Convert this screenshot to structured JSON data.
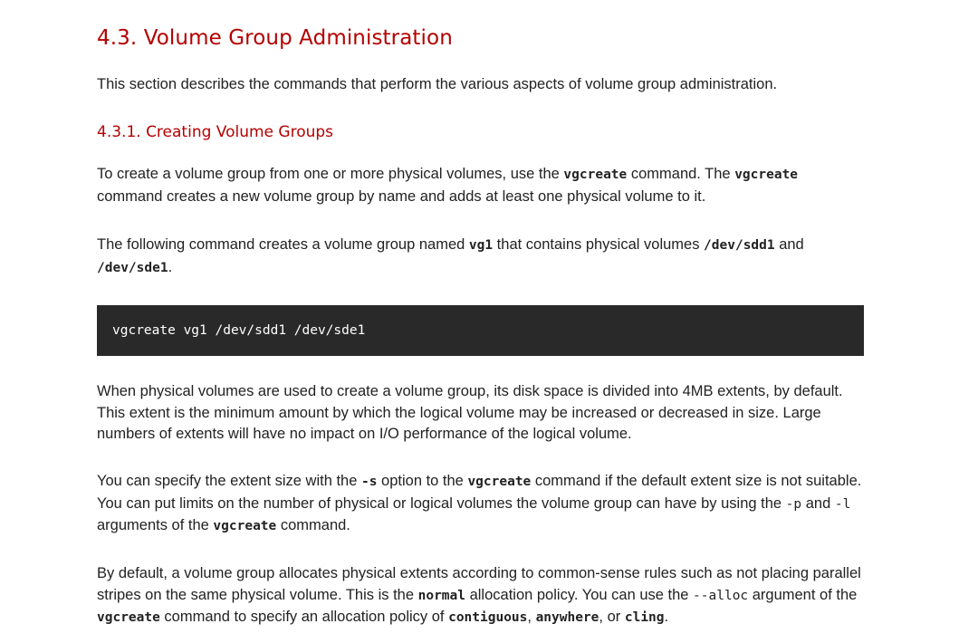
{
  "section": {
    "title": "4.3. Volume Group Administration",
    "intro": "This section describes the commands that perform the various aspects of volume group administration."
  },
  "subsection": {
    "title": "4.3.1. Creating Volume Groups"
  },
  "para_create": {
    "t1": "To create a volume group from one or more physical volumes, use the ",
    "c1": "vgcreate",
    "t2": " command. The ",
    "c2": "vgcreate",
    "t3": " command creates a new volume group by name and adds at least one physical volume to it."
  },
  "para_example": {
    "t1": "The following command creates a volume group named ",
    "c1": "vg1",
    "t2": " that contains physical volumes ",
    "c2": "/dev/sdd1",
    "t3": " and ",
    "c3": "/dev/sde1",
    "t4": "."
  },
  "code_block": {
    "command": "vgcreate vg1 /dev/sdd1 /dev/sde1"
  },
  "para_extents": {
    "text": "When physical volumes are used to create a volume group, its disk space is divided into 4MB extents, by default. This extent is the minimum amount by which the logical volume may be increased or decreased in size. Large numbers of extents will have no impact on I/O performance of the logical volume."
  },
  "para_size": {
    "t1": "You can specify the extent size with the ",
    "c1": "-s",
    "t2": " option to the ",
    "c2": "vgcreate",
    "t3": " command if the default extent size is not suitable. You can put limits on the number of physical or logical volumes the volume group can have by using the ",
    "c3": "-p",
    "t4": " and ",
    "c4": "-l",
    "t5": " arguments of the ",
    "c5": "vgcreate",
    "t6": " command."
  },
  "para_alloc": {
    "t1": "By default, a volume group allocates physical extents according to common-sense rules such as not placing parallel stripes on the same physical volume. This is the ",
    "c1": "normal",
    "t2": " allocation policy. You can use the ",
    "c2": "--alloc",
    "t3": " argument of the ",
    "c3": "vgcreate",
    "t4": " command to specify an allocation policy of ",
    "c4": "contiguous",
    "t5": ", ",
    "c5": "anywhere",
    "t6": ", or ",
    "c6": "cling",
    "t7": "."
  }
}
